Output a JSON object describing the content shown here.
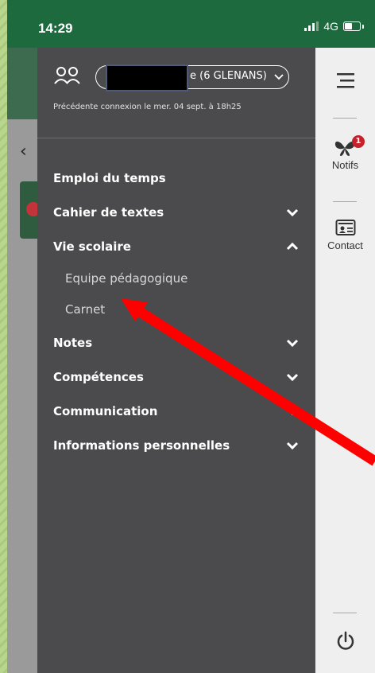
{
  "status_bar": {
    "time": "14:29",
    "network": "4G"
  },
  "drawer": {
    "account_selector_label": "e (6 GLENANS)",
    "last_login": "Précédente connexion le mer. 04 sept. à 18h25",
    "menu": [
      {
        "label": "Emploi du temps",
        "chevron": "none"
      },
      {
        "label": "Cahier de textes",
        "chevron": "down"
      },
      {
        "label": "Vie scolaire",
        "chevron": "up",
        "subitems": [
          {
            "label": "Equipe pédagogique"
          },
          {
            "label": "Carnet"
          }
        ]
      },
      {
        "label": "Notes",
        "chevron": "down"
      },
      {
        "label": "Compétences",
        "chevron": "down"
      },
      {
        "label": "Communication",
        "chevron": "down"
      },
      {
        "label": "Informations personnelles",
        "chevron": "down"
      }
    ]
  },
  "rail": {
    "notifs_label": "Notifs",
    "notifs_badge": "1",
    "contact_label": "Contact"
  },
  "colors": {
    "status_bar": "#1d6a3f",
    "drawer_bg": "#4b4b4d",
    "rail_bg": "#efefef",
    "badge": "#c8202b",
    "annotation_arrow": "#ff0000"
  }
}
